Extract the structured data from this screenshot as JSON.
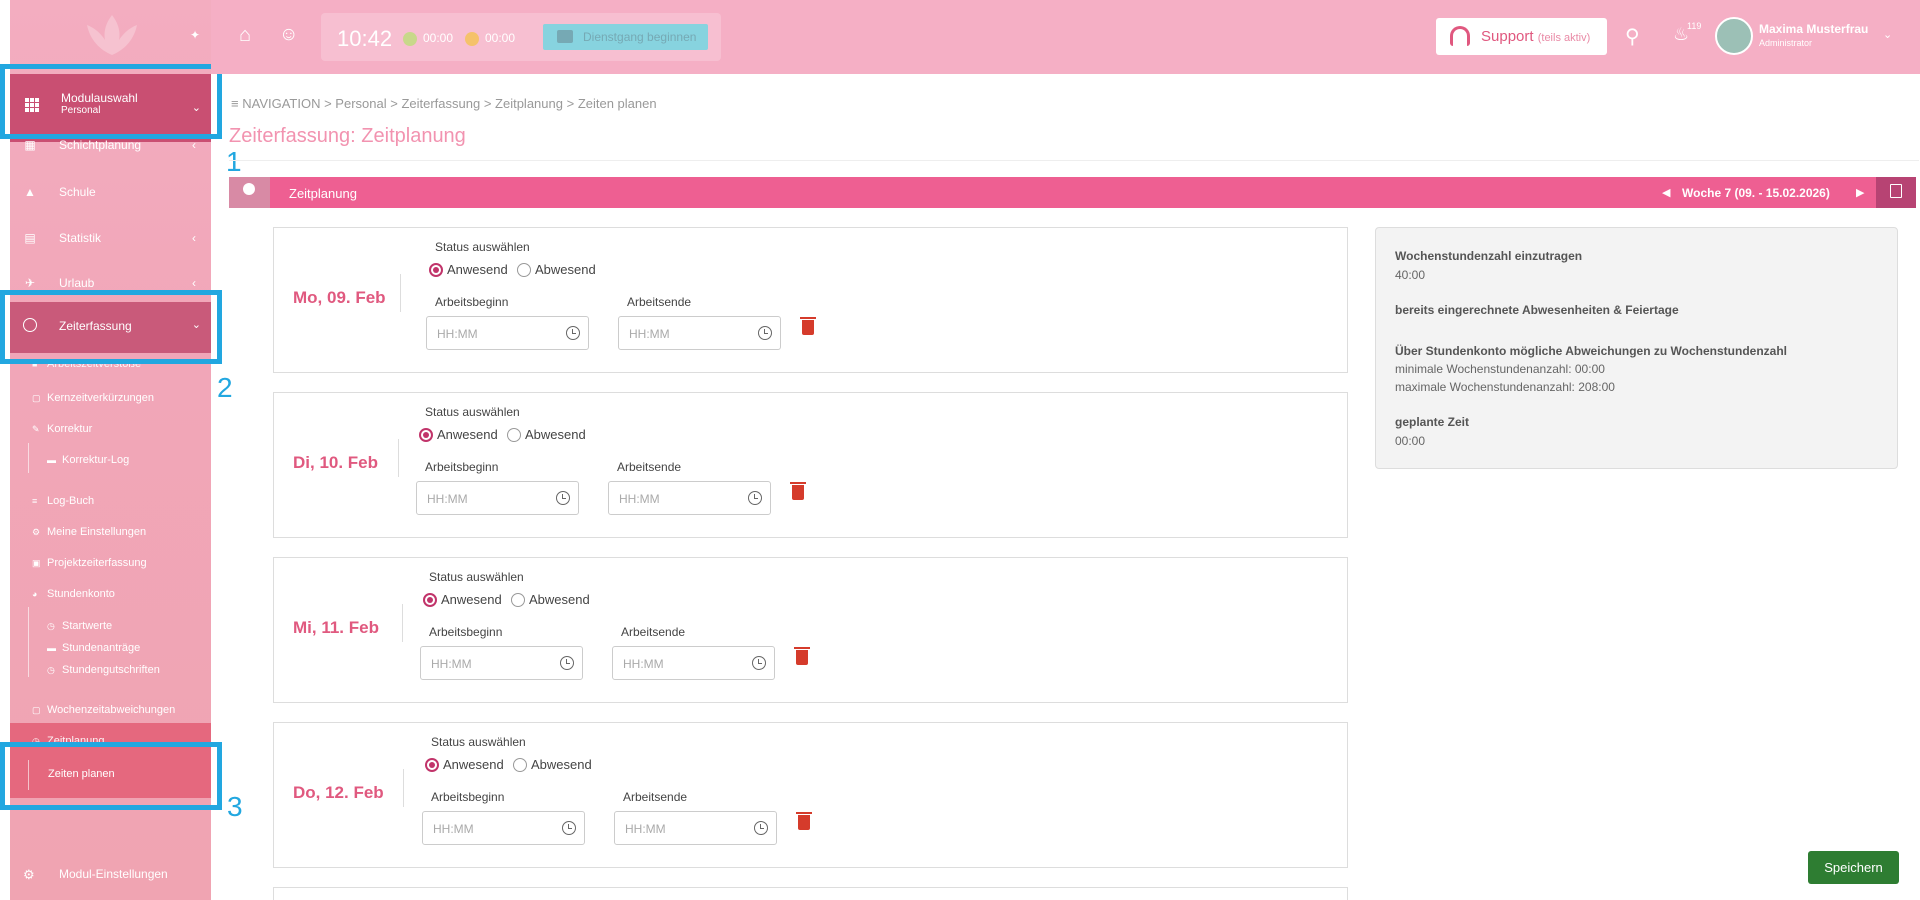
{
  "topbar": {
    "clock": "10:42",
    "timer1": "00:00",
    "timer2": "00:00",
    "dienstgang_label": "Dienstgang beginnen",
    "support_label": "Support",
    "support_sub": "(teils aktiv)",
    "notification_count": "119",
    "user_name": "Maxima Musterfrau",
    "user_role": "Administrator"
  },
  "sidebar": {
    "module_title": "Modulauswahl",
    "module_sub": "Personal",
    "items": [
      {
        "label": "Schichtplanung",
        "icon": "calendar-icon"
      },
      {
        "label": "Schule",
        "icon": "graduation-cap-icon"
      },
      {
        "label": "Statistik",
        "icon": "chart-icon"
      },
      {
        "label": "Urlaub",
        "icon": "plane-icon"
      }
    ],
    "zeiterfassung_label": "Zeiterfassung",
    "sub_partial": "Arbeitszeitverstöße",
    "subitems": [
      {
        "label": "Kernzeitverkürzungen"
      },
      {
        "label": "Korrektur"
      },
      {
        "label": "Korrektur-Log"
      },
      {
        "label": "Log-Buch"
      },
      {
        "label": "Meine Einstellungen"
      },
      {
        "label": "Projektzeiterfassung"
      },
      {
        "label": "Stundenkonto"
      },
      {
        "label": "Startwerte"
      },
      {
        "label": "Stundenanträge"
      },
      {
        "label": "Stundengutschriften"
      },
      {
        "label": "Wochenzeitabweichungen"
      },
      {
        "label": "Zeitplanung"
      }
    ],
    "active_item": "Zeiten planen",
    "module_settings": "Modul-Einstellungen"
  },
  "annotations": [
    "1",
    "2",
    "3"
  ],
  "breadcrumb": {
    "root": "NAVIGATION",
    "path": [
      "Personal",
      "Zeiterfassung",
      "Zeitplanung",
      "Zeiten planen"
    ]
  },
  "page_title": "Zeiterfassung: Zeitplanung",
  "panel": {
    "title": "Zeitplanung",
    "week": "Woche 7 (09. - 15.02.2026)"
  },
  "day_labels": {
    "status": "Status auswählen",
    "anwesend": "Anwesend",
    "abwesend": "Abwesend",
    "start": "Arbeitsbeginn",
    "end": "Arbeitsende",
    "placeholder": "HH:MM"
  },
  "days": [
    {
      "label": "Mo, 09. Feb"
    },
    {
      "label": "Di, 10. Feb"
    },
    {
      "label": "Mi, 11. Feb"
    },
    {
      "label": "Do, 12. Feb"
    }
  ],
  "info": {
    "h1": "Wochenstundenzahl einzutragen",
    "v1": "40:00",
    "h2": "bereits eingerechnete Abwesenheiten & Feiertage",
    "h3": "Über Stundenkonto mögliche Abweichungen zu Wochenstundenzahl",
    "v3a": "minimale Wochenstundenanzahl: 00:00",
    "v3b": "maximale Wochenstundenanzahl: 208:00",
    "h4": "geplante Zeit",
    "v4": "00:00"
  },
  "save_label": "Speichern"
}
